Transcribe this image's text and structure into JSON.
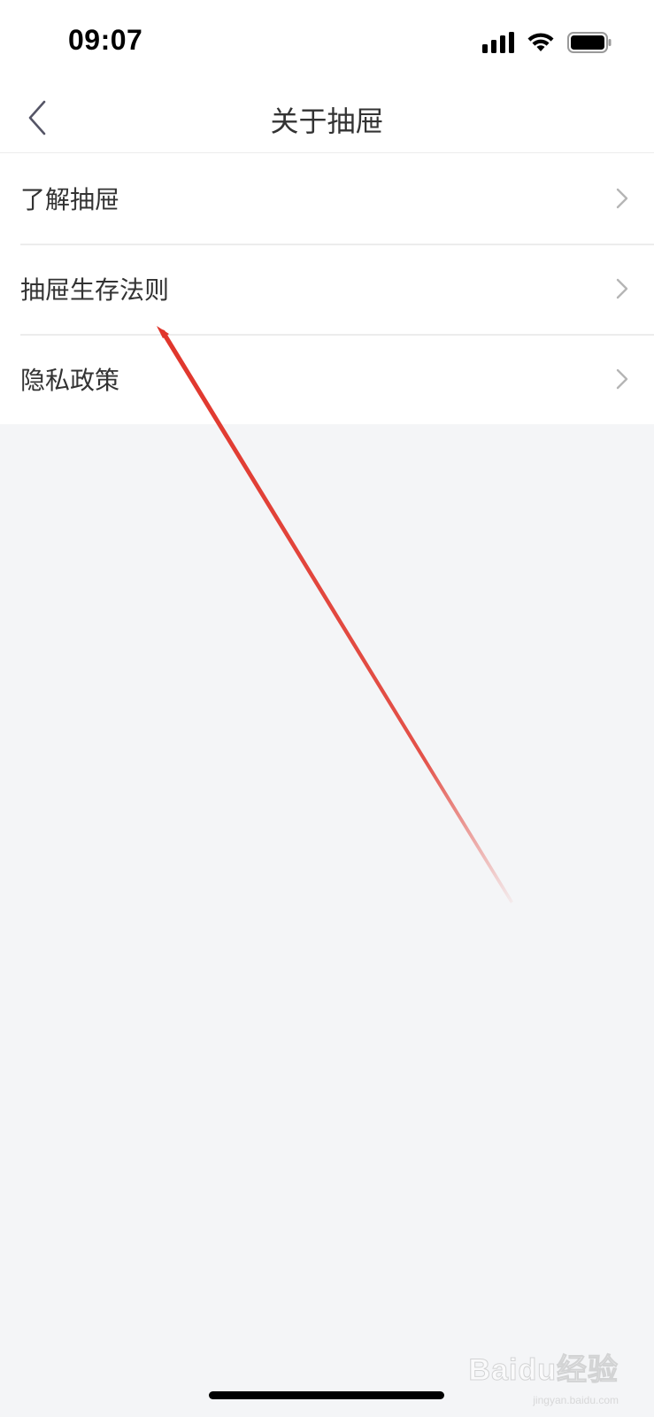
{
  "status_bar": {
    "time": "09:07",
    "icons": [
      "signal-icon",
      "wifi-icon",
      "battery-icon"
    ]
  },
  "nav": {
    "back_icon": "chevron-left-icon",
    "title": "关于抽屉"
  },
  "menu": {
    "items": [
      {
        "label": "了解抽屉",
        "icon": "chevron-right-icon"
      },
      {
        "label": "抽屉生存法则",
        "icon": "chevron-right-icon"
      },
      {
        "label": "隐私政策",
        "icon": "chevron-right-icon"
      }
    ]
  },
  "annotation": {
    "type": "arrow",
    "color": "#e0352b"
  },
  "watermark": {
    "text": "Baidu经验",
    "sub": "jingyan.baidu.com"
  },
  "colors": {
    "background": "#f4f5f7",
    "surface": "#ffffff",
    "text": "#333333",
    "divider": "#ececec",
    "chevron": "#b5b5b5",
    "back_icon": "#555566"
  }
}
